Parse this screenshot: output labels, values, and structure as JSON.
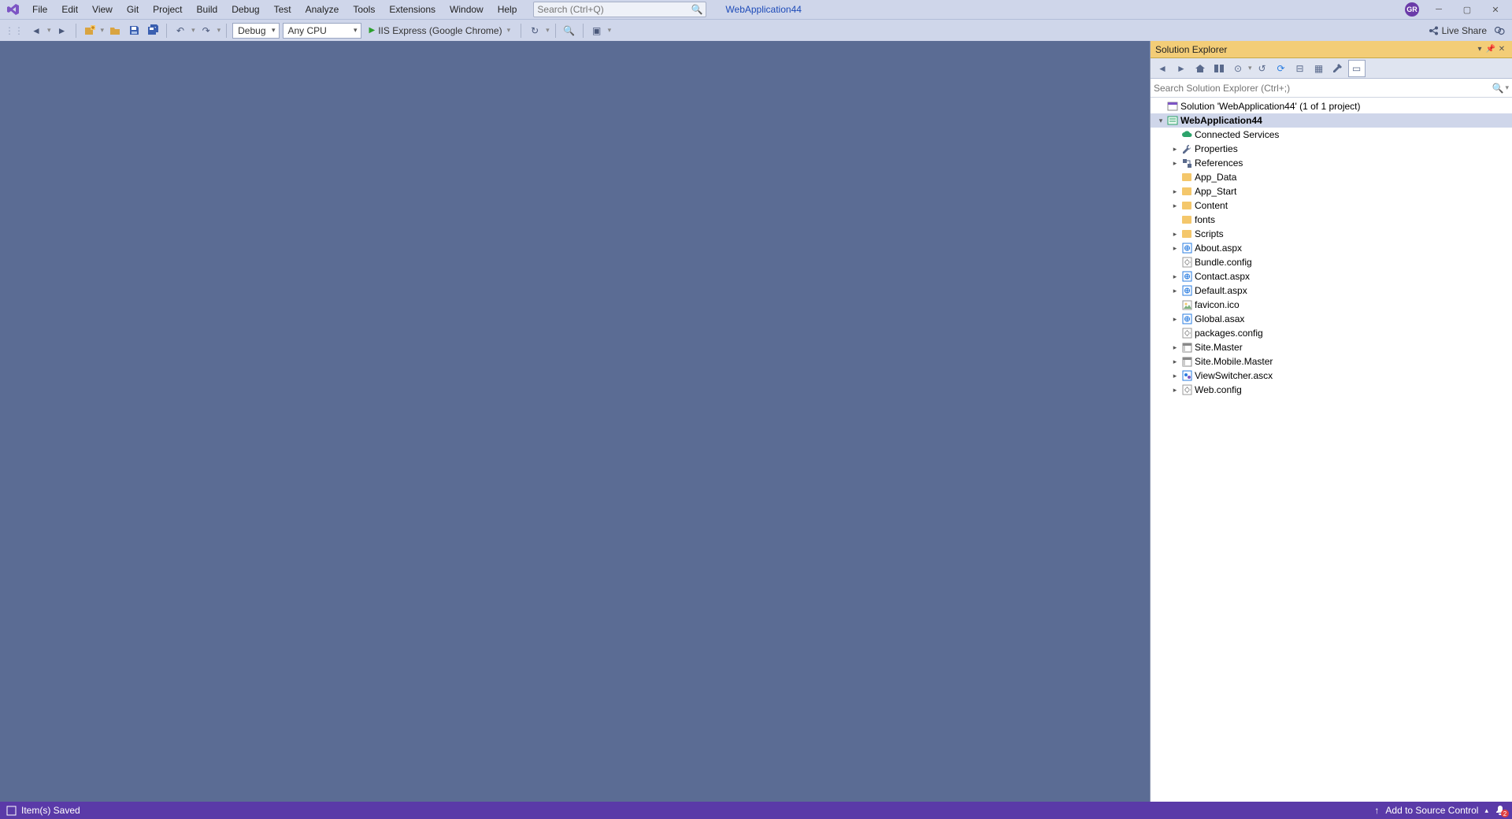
{
  "menu": [
    "File",
    "Edit",
    "View",
    "Git",
    "Project",
    "Build",
    "Debug",
    "Test",
    "Analyze",
    "Tools",
    "Extensions",
    "Window",
    "Help"
  ],
  "title_search_placeholder": "Search (Ctrl+Q)",
  "app_title": "WebApplication44",
  "avatar": "GR",
  "toolbar": {
    "config": "Debug",
    "platform": "Any CPU",
    "run_label": "IIS Express (Google Chrome)",
    "liveshare": "Live Share"
  },
  "panel": {
    "title": "Solution Explorer",
    "search_placeholder": "Search Solution Explorer (Ctrl+;)"
  },
  "tree": [
    {
      "depth": 0,
      "tw": "",
      "icon": "sln",
      "label": "Solution 'WebApplication44' (1 of 1 project)",
      "bold": false,
      "selected": false
    },
    {
      "depth": 0,
      "tw": "▾",
      "icon": "proj",
      "label": "WebApplication44",
      "bold": true,
      "selected": true
    },
    {
      "depth": 1,
      "tw": "",
      "icon": "cloud",
      "label": "Connected Services"
    },
    {
      "depth": 1,
      "tw": "▸",
      "icon": "wrench",
      "label": "Properties"
    },
    {
      "depth": 1,
      "tw": "▸",
      "icon": "refs",
      "label": "References"
    },
    {
      "depth": 1,
      "tw": "",
      "icon": "folder",
      "label": "App_Data"
    },
    {
      "depth": 1,
      "tw": "▸",
      "icon": "folder",
      "label": "App_Start"
    },
    {
      "depth": 1,
      "tw": "▸",
      "icon": "folder",
      "label": "Content"
    },
    {
      "depth": 1,
      "tw": "",
      "icon": "folder",
      "label": "fonts"
    },
    {
      "depth": 1,
      "tw": "▸",
      "icon": "folder",
      "label": "Scripts"
    },
    {
      "depth": 1,
      "tw": "▸",
      "icon": "aspx",
      "label": "About.aspx"
    },
    {
      "depth": 1,
      "tw": "",
      "icon": "cfg",
      "label": "Bundle.config"
    },
    {
      "depth": 1,
      "tw": "▸",
      "icon": "aspx",
      "label": "Contact.aspx"
    },
    {
      "depth": 1,
      "tw": "▸",
      "icon": "aspx",
      "label": "Default.aspx"
    },
    {
      "depth": 1,
      "tw": "",
      "icon": "ico",
      "label": "favicon.ico"
    },
    {
      "depth": 1,
      "tw": "▸",
      "icon": "aspx",
      "label": "Global.asax"
    },
    {
      "depth": 1,
      "tw": "",
      "icon": "cfg",
      "label": "packages.config"
    },
    {
      "depth": 1,
      "tw": "▸",
      "icon": "master",
      "label": "Site.Master"
    },
    {
      "depth": 1,
      "tw": "▸",
      "icon": "master",
      "label": "Site.Mobile.Master"
    },
    {
      "depth": 1,
      "tw": "▸",
      "icon": "ascx",
      "label": "ViewSwitcher.ascx"
    },
    {
      "depth": 1,
      "tw": "▸",
      "icon": "cfg",
      "label": "Web.config"
    }
  ],
  "status": {
    "left": "Item(s) Saved",
    "source_control": "Add to Source Control",
    "notifications": "2"
  }
}
